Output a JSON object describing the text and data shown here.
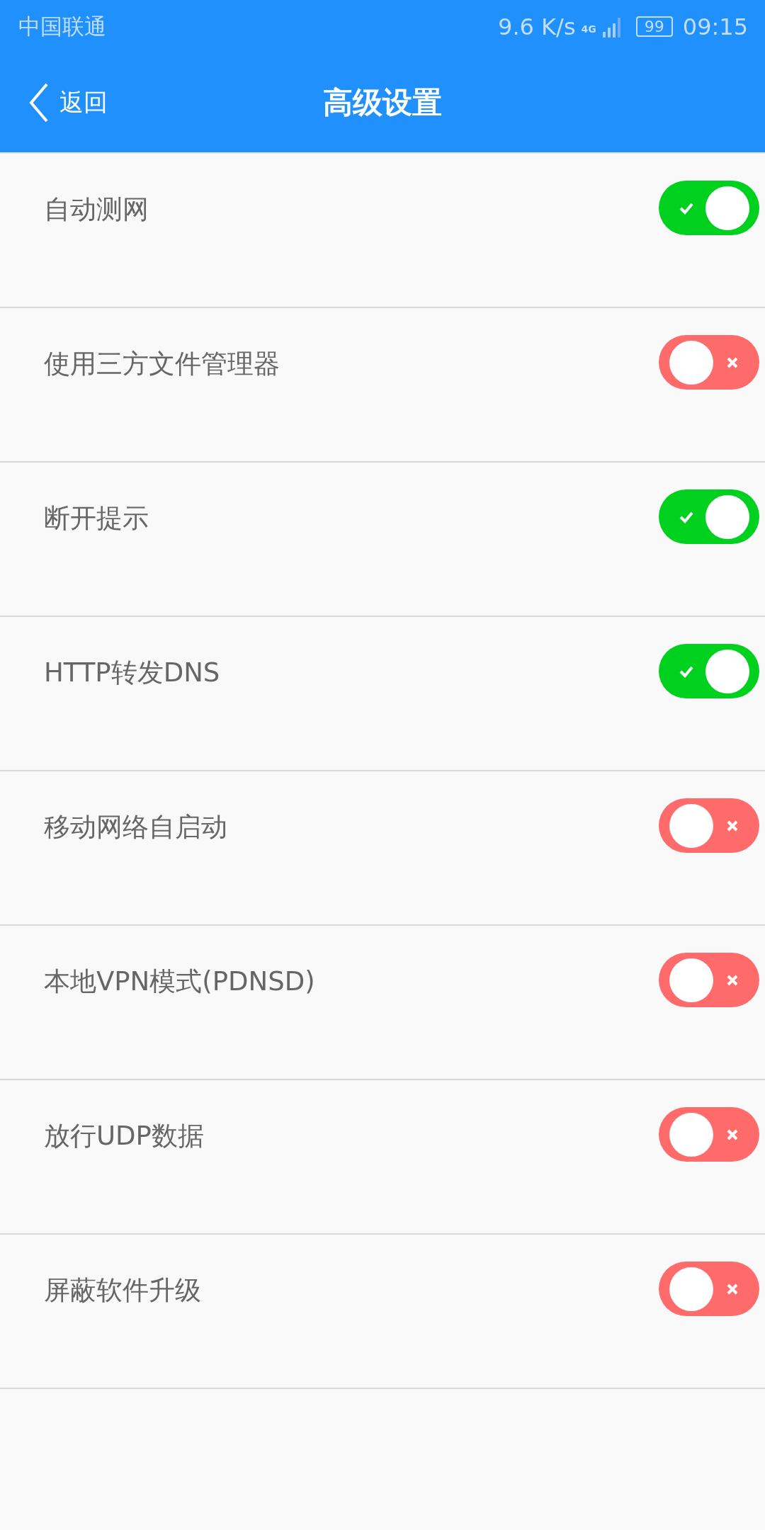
{
  "status_bar": {
    "carrier": "中国联通",
    "speed": "9.6 K/s",
    "network": "4G",
    "battery": "99",
    "time": "09:15"
  },
  "header": {
    "back": "返回",
    "title": "高级设置"
  },
  "settings": [
    {
      "label": "自动测网",
      "on": true
    },
    {
      "label": "使用三方文件管理器",
      "on": false
    },
    {
      "label": "断开提示",
      "on": true
    },
    {
      "label": "HTTP转发DNS",
      "on": true
    },
    {
      "label": "移动网络自启动",
      "on": false
    },
    {
      "label": "本地VPN模式(PDNSD)",
      "on": false
    },
    {
      "label": "放行UDP数据",
      "on": false
    },
    {
      "label": "屏蔽软件升级",
      "on": false
    }
  ]
}
